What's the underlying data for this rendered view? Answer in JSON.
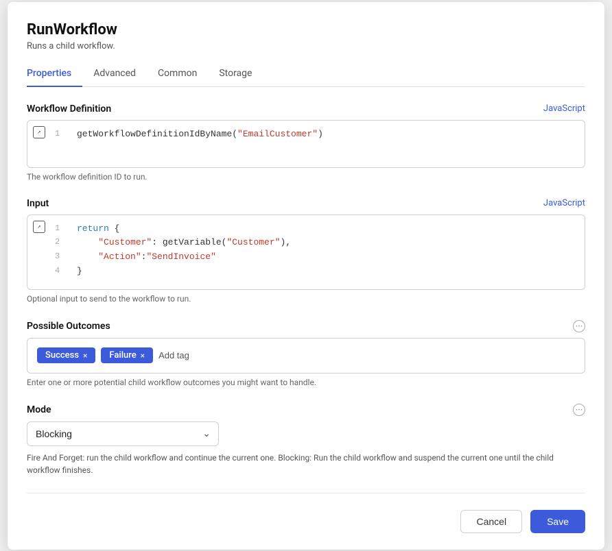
{
  "dialog": {
    "title": "RunWorkflow",
    "subtitle": "Runs a child workflow."
  },
  "tabs": [
    {
      "label": "Properties",
      "active": true
    },
    {
      "label": "Advanced",
      "active": false
    },
    {
      "label": "Common",
      "active": false
    },
    {
      "label": "Storage",
      "active": false
    }
  ],
  "workflow_definition": {
    "label": "Workflow Definition",
    "js_label": "JavaScript",
    "code_line1_num": "1",
    "code_line1": "getWorkflowDefinitionIdByName(\"EmailCustomer\")",
    "hint": "The workflow definition ID to run."
  },
  "input": {
    "label": "Input",
    "js_label": "JavaScript",
    "code_lines": [
      {
        "num": "1",
        "text": "return {"
      },
      {
        "num": "2",
        "text": "    \"Customer\": getVariable(\"Customer\"),"
      },
      {
        "num": "3",
        "text": "    \"Action\":\"SendInvoice\""
      },
      {
        "num": "4",
        "text": "}"
      }
    ],
    "hint": "Optional input to send to the workflow to run."
  },
  "possible_outcomes": {
    "label": "Possible Outcomes",
    "tags": [
      {
        "label": "Success",
        "type": "success"
      },
      {
        "label": "Failure",
        "type": "failure"
      }
    ],
    "add_tag_label": "Add tag",
    "hint": "Enter one or more potential child workflow outcomes you might want to handle."
  },
  "mode": {
    "label": "Mode",
    "options": [
      "Blocking",
      "Fire And Forget"
    ],
    "selected": "Blocking",
    "hint": "Fire And Forget: run the child workflow and continue the current one. Blocking: Run the child workflow and suspend the current one until the child workflow finishes."
  },
  "footer": {
    "cancel_label": "Cancel",
    "save_label": "Save"
  }
}
